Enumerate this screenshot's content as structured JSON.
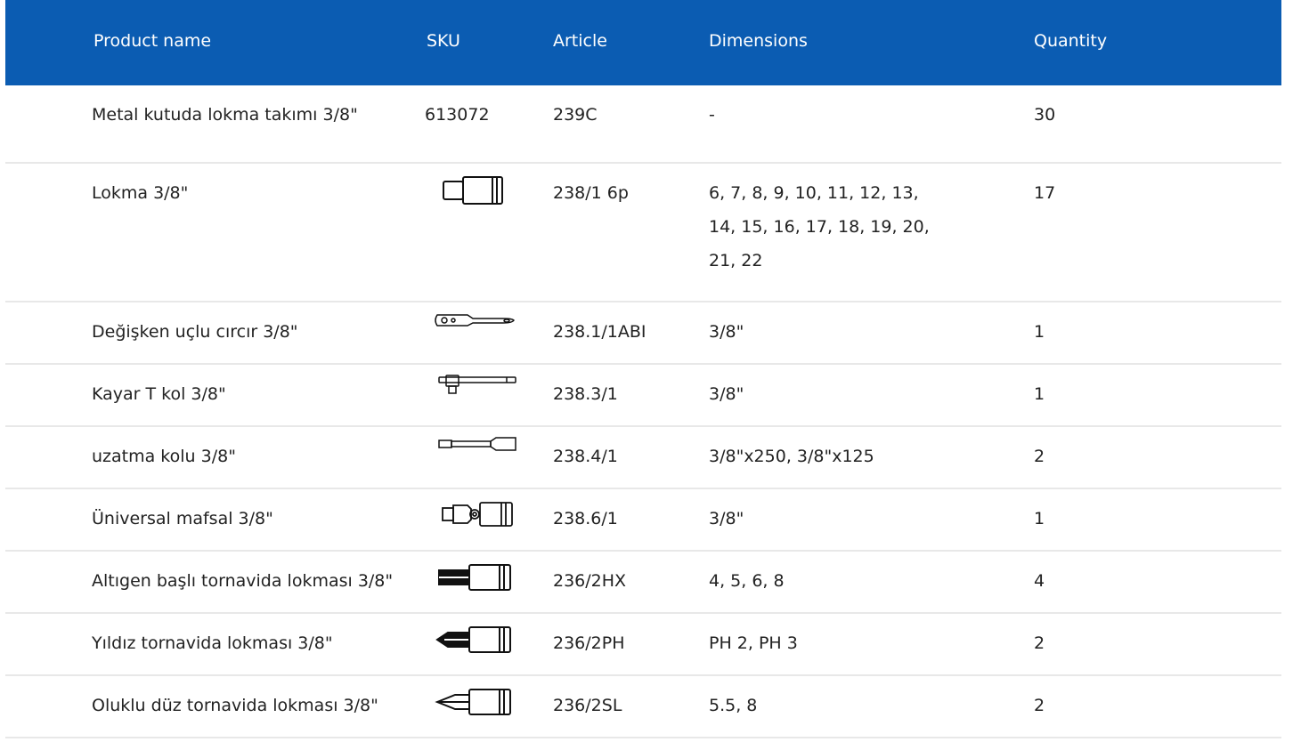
{
  "table": {
    "headers": {
      "product_name": "Product name",
      "sku": "SKU",
      "article": "Article",
      "dimensions": "Dimensions",
      "quantity": "Quantity"
    },
    "rows": [
      {
        "name": "Metal kutuda lokma takımı 3/8\"",
        "sku": "613072",
        "sku_icon": null,
        "article": "239C",
        "dimensions": "-",
        "quantity": "30"
      },
      {
        "name": "Lokma 3/8\"",
        "sku": "",
        "sku_icon": "socket-icon",
        "article": "238/1 6p",
        "dimensions": "6, 7, 8, 9, 10, 11, 12, 13, 14, 15, 16, 17, 18, 19, 20, 21, 22",
        "quantity": "17"
      },
      {
        "name": "Değişken uçlu cırcır 3/8\"",
        "sku": "",
        "sku_icon": "ratchet-icon",
        "article": "238.1/1ABI",
        "dimensions": "3/8\"",
        "quantity": "1"
      },
      {
        "name": "Kayar T kol 3/8\"",
        "sku": "",
        "sku_icon": "t-handle-icon",
        "article": "238.3/1",
        "dimensions": "3/8\"",
        "quantity": "1"
      },
      {
        "name": "uzatma kolu 3/8\"",
        "sku": "",
        "sku_icon": "extension-bar-icon",
        "article": "238.4/1",
        "dimensions": "3/8\"x250, 3/8\"x125",
        "quantity": "2"
      },
      {
        "name": "Üniversal mafsal 3/8\"",
        "sku": "",
        "sku_icon": "universal-joint-icon",
        "article": "238.6/1",
        "dimensions": "3/8\"",
        "quantity": "1"
      },
      {
        "name": "Altıgen başlı tornavida lokması 3/8\"",
        "sku": "",
        "sku_icon": "hex-bit-socket-icon",
        "article": "236/2HX",
        "dimensions": "4, 5, 6, 8",
        "quantity": "4"
      },
      {
        "name": "Yıldız tornavida lokması 3/8\"",
        "sku": "",
        "sku_icon": "phillips-bit-socket-icon",
        "article": "236/2PH",
        "dimensions": "PH 2, PH 3",
        "quantity": "2"
      },
      {
        "name": "Oluklu düz tornavida lokması 3/8\"",
        "sku": "",
        "sku_icon": "slotted-bit-socket-icon",
        "article": "236/2SL",
        "dimensions": "5.5, 8",
        "quantity": "2"
      }
    ]
  },
  "colors": {
    "header_bg": "#0b5cb2",
    "header_text": "#ffffff",
    "row_divider": "#e8e8e8"
  }
}
